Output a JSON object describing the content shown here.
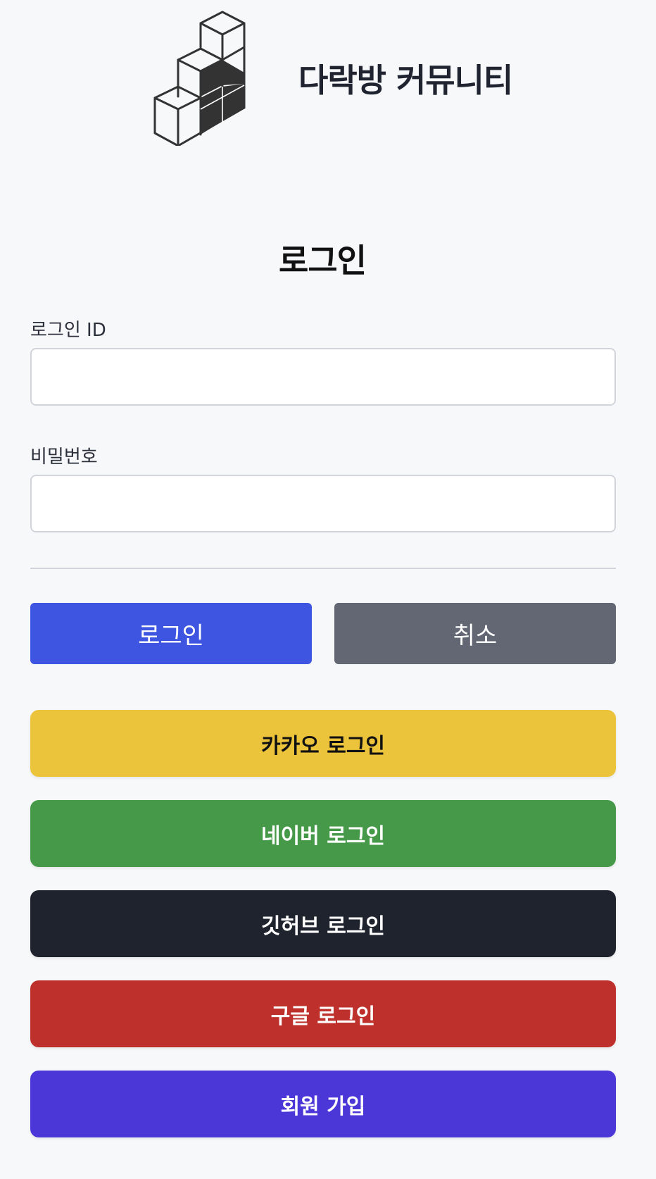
{
  "header": {
    "brand": "다락방 커뮤니티",
    "logo_icon": "stacked-cubes-logo"
  },
  "login_form": {
    "title": "로그인",
    "id_label": "로그인 ID",
    "id_value": "",
    "password_label": "비밀번호",
    "password_value": ""
  },
  "actions": {
    "login_label": "로그인",
    "cancel_label": "취소"
  },
  "social_buttons": [
    {
      "label": "카카오 로그인",
      "bg": "#ecc43c",
      "color": "#111111"
    },
    {
      "label": "네이버 로그인",
      "bg": "#47994a",
      "color": "#ffffff"
    },
    {
      "label": "깃허브 로그인",
      "bg": "#1f232d",
      "color": "#ffffff"
    },
    {
      "label": "구글 로그인",
      "bg": "#bd302c",
      "color": "#ffffff"
    },
    {
      "label": "회원 가입",
      "bg": "#4b36d8",
      "color": "#ffffff"
    }
  ],
  "colors": {
    "background": "#f7f8fa",
    "primary": "#3d55e0",
    "cancel": "#636774"
  }
}
